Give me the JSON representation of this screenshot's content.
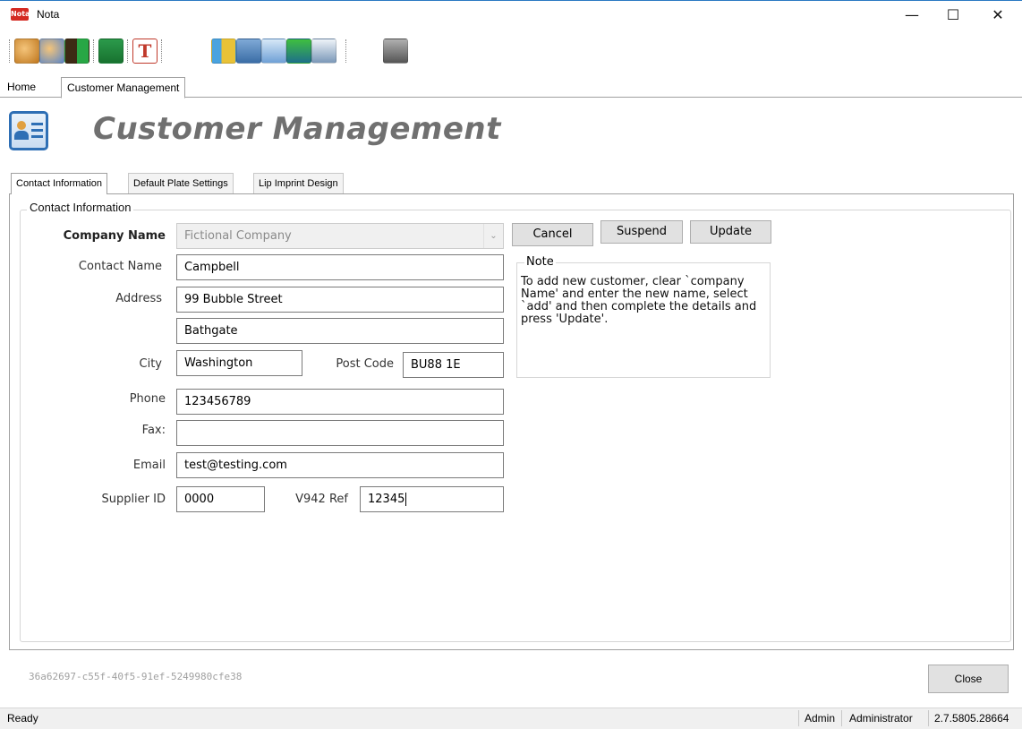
{
  "window": {
    "app_icon_text": "Nota",
    "title": "Nota",
    "minimize_glyph": "—",
    "maximize_glyph": "☐",
    "close_glyph": "✕"
  },
  "toolbar": {
    "icons": [
      "add-customer-icon",
      "edit-customer-icon",
      "exit-icon",
      "export-icon",
      "text-icon",
      "plate-icon",
      "gallery-icon",
      "customer-card-icon",
      "sql-icon",
      "settings-icon",
      "safe-icon"
    ],
    "text_icon_glyph": "T"
  },
  "top_tabs": [
    "Home",
    "Customer Management"
  ],
  "header": {
    "title": "Customer Management"
  },
  "inner_tabs": [
    "Contact Information",
    "Default Plate Settings",
    "Lip Imprint Design"
  ],
  "form": {
    "group_title": "Contact Information",
    "company_name_label": "Company Name",
    "company_name_value": "Fictional Company",
    "contact_name_label": "Contact Name",
    "contact_name_value": "Campbell",
    "address_label": "Address",
    "address_line1": "99 Bubble Street",
    "address_line2": "Bathgate",
    "city_label": "City",
    "city_value": "Washington",
    "post_code_label": "Post Code",
    "post_code_value": "BU88 1E",
    "phone_label": "Phone",
    "phone_value": "123456789",
    "fax_label": "Fax:",
    "fax_value": "",
    "email_label": "Email",
    "email_value": "test@testing.com",
    "supplier_id_label": "Supplier ID",
    "supplier_id_value": "0000",
    "v942_label": "V942 Ref",
    "v942_value": "12345"
  },
  "buttons": {
    "cancel": "Cancel",
    "suspend": "Suspend",
    "update": "Update",
    "close": "Close"
  },
  "note": {
    "title": "Note",
    "text": "To add new customer, clear `company Name' and enter the new name, select `add' and then complete the details and press 'Update'."
  },
  "footer": {
    "guid": "36a62697-c55f-40f5-91ef-5249980cfe38"
  },
  "status": {
    "left": "Ready",
    "user": "Admin",
    "role": "Administrator",
    "version": "2.7.5805.28664"
  },
  "colors": {
    "accent": "#2e6fb5",
    "title_grey": "#707070",
    "app_red": "#d42a22"
  }
}
